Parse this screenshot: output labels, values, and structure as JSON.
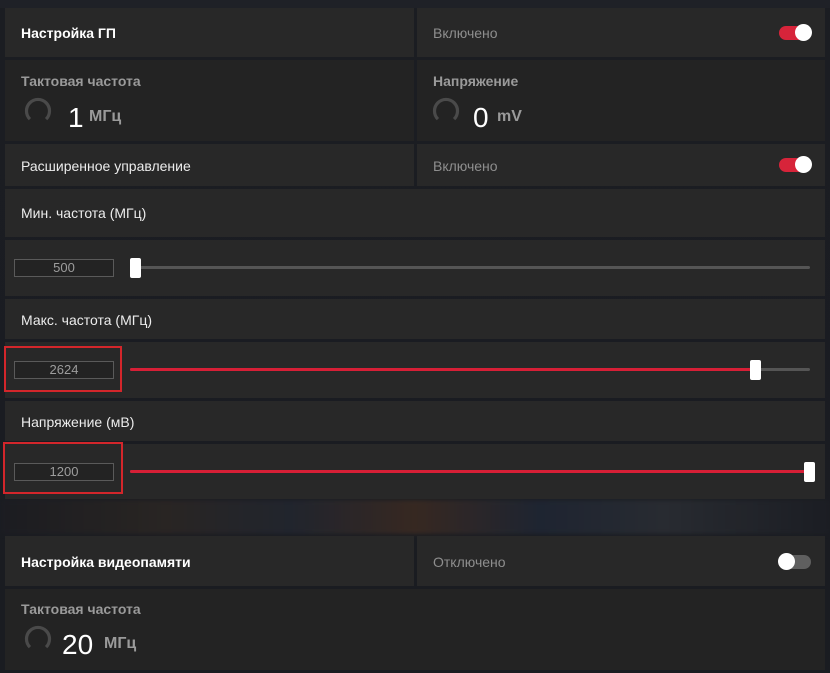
{
  "gpu": {
    "title": "Настройка ГП",
    "state": "Включено",
    "clock_label": "Тактовая частота",
    "clock_value": "1",
    "clock_unit": "МГц",
    "voltage_label": "Напряжение",
    "voltage_value": "0",
    "voltage_unit": "mV"
  },
  "advanced": {
    "label": "Расширенное управление",
    "state": "Включено"
  },
  "min_freq": {
    "label": "Мин. частота (МГц)",
    "value": "500",
    "level_percent": 0
  },
  "max_freq": {
    "label": "Макс. частота (МГц)",
    "value": "2624",
    "level_percent": 92
  },
  "voltage": {
    "label": "Напряжение (мВ)",
    "value": "1200",
    "level_percent": 100
  },
  "vram": {
    "title": "Настройка видеопамяти",
    "state": "Отключено",
    "clock_label": "Тактовая частота",
    "clock_value": "20",
    "clock_unit": "МГц"
  },
  "colors": {
    "accent": "#d61f36",
    "panel": "#282828",
    "highlight_border": "#d3262b"
  },
  "icons": [
    "gauge-icon",
    "toggle-switch"
  ]
}
